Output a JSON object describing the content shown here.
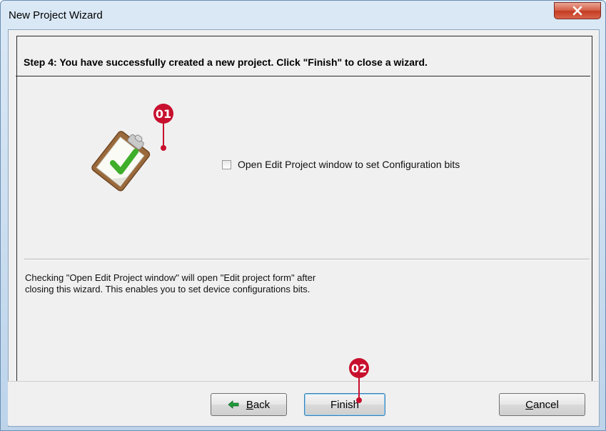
{
  "window": {
    "title": "New Project Wizard",
    "close_symbol": "x"
  },
  "wizard": {
    "step_header": "Step 4: You have successfully created a new project.  Click \"Finish\" to close a wizard.",
    "checkbox_label": "Open Edit Project window to set Configuration bits",
    "checkbox_checked": false,
    "note_line1": "Checking \"Open Edit Project window\" will open \"Edit project form\" after",
    "note_line2": "closing this wizard. This enables you to set device configurations bits."
  },
  "buttons": {
    "back_mnemonic": "B",
    "back_rest": "ack",
    "finish": "Finish",
    "cancel_mnemonic": "C",
    "cancel_rest": "ancel"
  },
  "callouts": {
    "one": "01",
    "two": "02"
  },
  "icons": {
    "clipboard": "clipboard-check-icon",
    "back_arrow": "arrow-left-icon",
    "close": "close-icon"
  },
  "colors": {
    "callout": "#c8102e",
    "check_green": "#3fae2a",
    "close_red": "#c23b22"
  }
}
